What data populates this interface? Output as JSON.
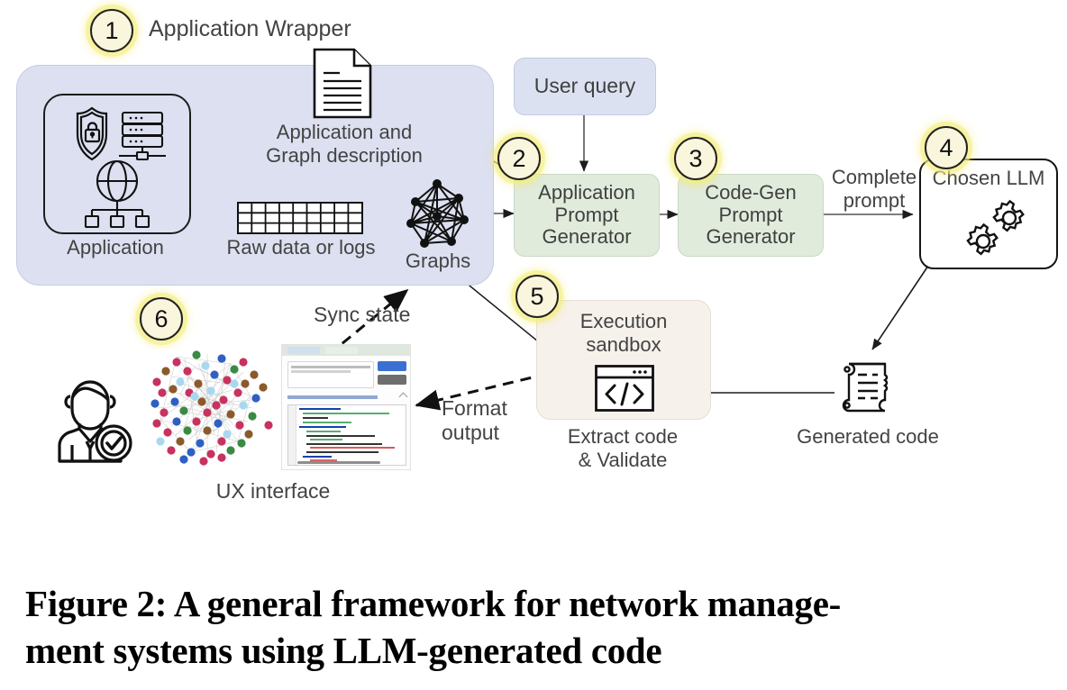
{
  "figure": {
    "caption": "Figure 2: A general framework for network management systems using LLM-generated code",
    "caption_line1": "Figure 2: A general framework for network manage-",
    "caption_line2": "ment systems using LLM-generated code"
  },
  "colors": {
    "wrapper_fill": "#dce0f0",
    "blue_node": "#dce1f2",
    "green_node": "#e0ebdc",
    "cream_node": "#f7f1ec",
    "badge_fill": "#faf6dd",
    "badge_glow": "#f0e85a",
    "stroke": "#1c1c1c",
    "text": "#434343"
  },
  "badges": [
    {
      "number": "1",
      "for": "application-wrapper"
    },
    {
      "number": "2",
      "for": "application-prompt-generator"
    },
    {
      "number": "3",
      "for": "code-gen-prompt-generator"
    },
    {
      "number": "4",
      "for": "chosen-llm"
    },
    {
      "number": "5",
      "for": "execution-sandbox"
    },
    {
      "number": "6",
      "for": "ux-interface"
    }
  ],
  "wrapper": {
    "title": "Application Wrapper",
    "items": [
      {
        "id": "application",
        "label": "Application",
        "icons": [
          "shield-lock-icon",
          "server-rack-icon",
          "globe-network-icon"
        ]
      },
      {
        "id": "app-graph-description",
        "label_line1": "Application and",
        "label_line2": "Graph description",
        "icon": "document-icon"
      },
      {
        "id": "raw-data",
        "label": "Raw data or logs",
        "icon": "table-icon",
        "table_cols": 9,
        "table_rows": 3
      },
      {
        "id": "graphs",
        "label": "Graphs",
        "icon": "node-graph-icon"
      }
    ]
  },
  "nodes": [
    {
      "id": "user-query",
      "label": "User query",
      "style": "blue"
    },
    {
      "id": "application-prompt-generator",
      "label_line1": "Application",
      "label_line2": "Prompt",
      "label_line3": "Generator",
      "style": "green"
    },
    {
      "id": "code-gen-prompt-generator",
      "label_line1": "Code-Gen",
      "label_line2": "Prompt",
      "label_line3": "Generator",
      "style": "green"
    },
    {
      "id": "chosen-llm",
      "label": "Chosen LLM",
      "style": "white",
      "icon": "gears-icon"
    },
    {
      "id": "execution-sandbox",
      "label_line1": "Execution",
      "label_line2": "sandbox",
      "style": "cream",
      "icon": "code-window-icon"
    },
    {
      "id": "generated-code",
      "label": "Generated code",
      "icon": "scroll-icon"
    },
    {
      "id": "ux-interface",
      "label": "UX interface",
      "icons": [
        "user-check-icon",
        "network-graph-icon",
        "app-screenshot-icon"
      ]
    }
  ],
  "edge_labels": [
    {
      "id": "complete-prompt",
      "line1": "Complete",
      "line2": "prompt"
    },
    {
      "id": "sync-state",
      "line1": "Sync state"
    },
    {
      "id": "format-output",
      "line1": "Format",
      "line2": "output"
    },
    {
      "id": "extract-code-validate",
      "line1": "Extract code",
      "line2": "& Validate"
    }
  ],
  "ux_screenshot": {
    "prompt_text": "Assign a unique color to each /16 IP address prefix",
    "run_button": "Run",
    "reset_button": "Reset session",
    "code_section_title": "Code generated by the LLM"
  }
}
